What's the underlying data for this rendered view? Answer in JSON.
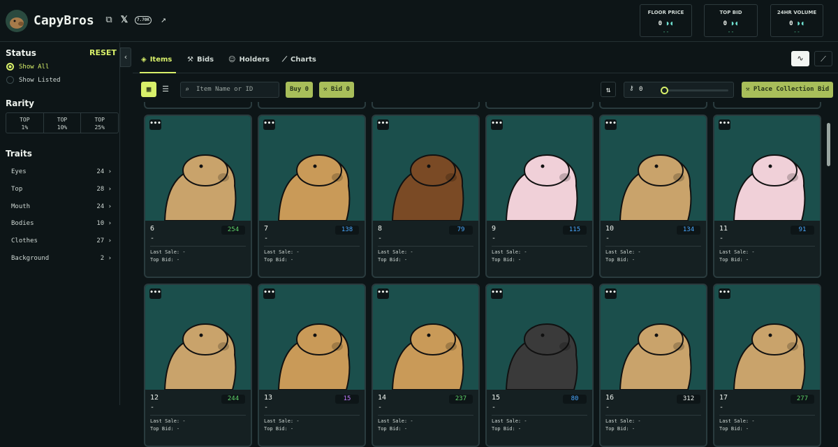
{
  "header": {
    "title": "CapyBros",
    "followers": "7.70K",
    "stats": [
      {
        "label": "FLOOR PRICE",
        "value": "0",
        "sub": "--"
      },
      {
        "label": "TOP BID",
        "value": "0",
        "sub": "--"
      },
      {
        "label": "24HR VOLUME",
        "value": "0",
        "sub": "--"
      }
    ]
  },
  "sidebar": {
    "status_title": "Status",
    "reset_label": "RESET",
    "status_options": [
      "Show All",
      "Show Listed"
    ],
    "rarity_title": "Rarity",
    "rarity": [
      [
        "TOP",
        "1%"
      ],
      [
        "TOP",
        "10%"
      ],
      [
        "TOP",
        "25%"
      ]
    ],
    "traits_title": "Traits",
    "traits": [
      {
        "name": "Eyes",
        "count": "24"
      },
      {
        "name": "Top",
        "count": "28"
      },
      {
        "name": "Mouth",
        "count": "24"
      },
      {
        "name": "Bodies",
        "count": "10"
      },
      {
        "name": "Clothes",
        "count": "27"
      },
      {
        "name": "Background",
        "count": "2"
      }
    ]
  },
  "tabs": [
    "Items",
    "Bids",
    "Holders",
    "Charts"
  ],
  "toolbar": {
    "search_placeholder": "Item Name or ID",
    "buy_label": "Buy 0",
    "bid_label": "Bid 0",
    "slider_value": "0",
    "collection_bid_label": "Place Collection Bid"
  },
  "cards": [
    {
      "id": "6",
      "rank": "254",
      "rank_color": "#5fd36a",
      "name": "-",
      "last_sale": "Last Sale: -",
      "top_bid": "Top Bid: -"
    },
    {
      "id": "7",
      "rank": "138",
      "rank_color": "#4aa8ff",
      "name": "-",
      "last_sale": "Last Sale: -",
      "top_bid": "Top Bid: -"
    },
    {
      "id": "8",
      "rank": "79",
      "rank_color": "#4aa8ff",
      "name": "-",
      "last_sale": "Last Sale: -",
      "top_bid": "Top Bid: -"
    },
    {
      "id": "9",
      "rank": "115",
      "rank_color": "#4aa8ff",
      "name": "-",
      "last_sale": "Last Sale: -",
      "top_bid": "Top Bid: -"
    },
    {
      "id": "10",
      "rank": "134",
      "rank_color": "#4aa8ff",
      "name": "-",
      "last_sale": "Last Sale: -",
      "top_bid": "Top Bid: -"
    },
    {
      "id": "11",
      "rank": "91",
      "rank_color": "#4aa8ff",
      "name": "-",
      "last_sale": "Last Sale: -",
      "top_bid": "Top Bid: -"
    },
    {
      "id": "12",
      "rank": "244",
      "rank_color": "#5fd36a",
      "name": "-",
      "last_sale": "Last Sale: -",
      "top_bid": "Top Bid: -"
    },
    {
      "id": "13",
      "rank": "15",
      "rank_color": "#c07aff",
      "name": "-",
      "last_sale": "Last Sale: -",
      "top_bid": "Top Bid: -"
    },
    {
      "id": "14",
      "rank": "237",
      "rank_color": "#5fd36a",
      "name": "-",
      "last_sale": "Last Sale: -",
      "top_bid": "Top Bid: -"
    },
    {
      "id": "15",
      "rank": "80",
      "rank_color": "#4aa8ff",
      "name": "-",
      "last_sale": "Last Sale: -",
      "top_bid": "Top Bid: -"
    },
    {
      "id": "16",
      "rank": "312",
      "rank_color": "#eef3ee",
      "name": "-",
      "last_sale": "Last Sale: -",
      "top_bid": "Top Bid: -"
    },
    {
      "id": "17",
      "rank": "277",
      "rank_color": "#5fd36a",
      "name": "-",
      "last_sale": "Last Sale: -",
      "top_bid": "Top Bid: -"
    }
  ]
}
